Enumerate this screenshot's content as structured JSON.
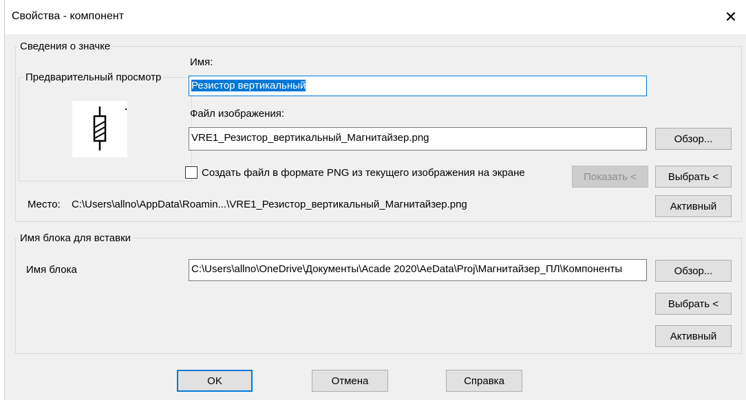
{
  "window": {
    "title": "Свойства - компонент",
    "close_glyph": "✕"
  },
  "icon_group": {
    "legend": "Сведения о значке",
    "preview_label": "Предварительный просмотр",
    "name_label": "Имя:",
    "name_value": "Резистор вертикальный",
    "file_label": "Файл изображения:",
    "file_value": "VRE1_Резистор_вертикальный_Магнитайзер.png",
    "browse_label": "Обзор...",
    "checkbox_label": "Создать файл в формате PNG из текущего изображения на экране",
    "checkbox_checked": false,
    "show_label": "Показать <",
    "pick_label": "Выбрать <",
    "location_label": "Место:",
    "location_value": "C:\\Users\\allno\\AppData\\Roamin...\\VRE1_Резистор_вертикальный_Магнитайзер.png",
    "active_label": "Активный"
  },
  "block_group": {
    "legend": "Имя блока для вставки",
    "block_label": "Имя блока",
    "block_value": "C:\\Users\\allno\\OneDrive\\Документы\\Acade 2020\\AeData\\Proj\\Магнитайзер_ПЛ\\Компоненты",
    "browse_label": "Обзор...",
    "pick_label": "Выбрать <",
    "active_label": "Активный"
  },
  "footer": {
    "ok_label": "OK",
    "cancel_label": "Отмена",
    "help_label": "Справка"
  },
  "icons": {
    "resistor": "resistor-symbol-icon",
    "close": "close-icon",
    "checkbox": "checkbox"
  }
}
